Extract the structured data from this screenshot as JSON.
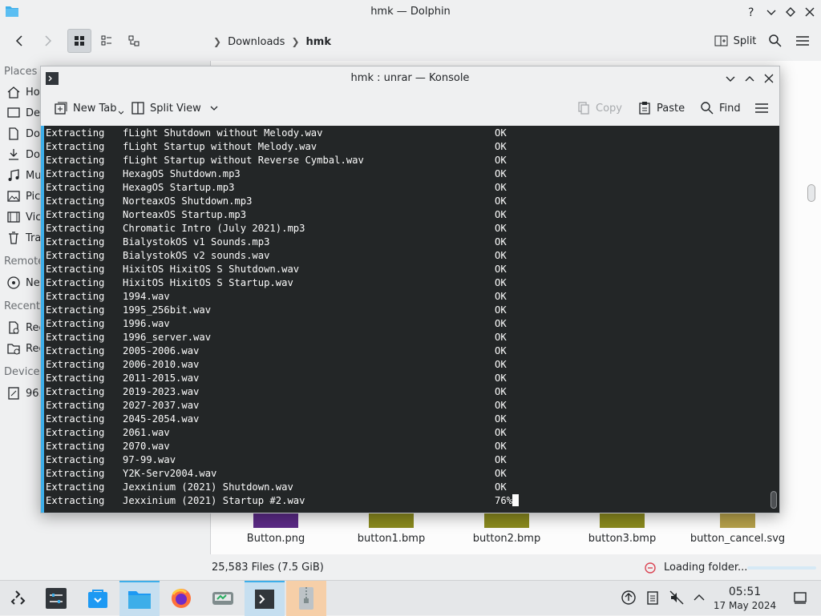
{
  "dolphin": {
    "title": "hmk — Dolphin",
    "split_label": "Split",
    "breadcrumb": [
      "Downloads",
      "hmk"
    ],
    "places": {
      "header": "Places",
      "items": [
        "Ho",
        "De",
        "Do",
        "Do",
        "Mu",
        "Pic",
        "Vic",
        "Tra"
      ],
      "remote_header": "Remote",
      "remote_items": [
        "Ne"
      ],
      "recent_header": "Recent",
      "recent_items": [
        "Rec",
        "Rec"
      ],
      "devices_header": "Devices",
      "devices_items": [
        "96."
      ]
    },
    "files": [
      {
        "name": "Button.png",
        "color": "#5b2a86"
      },
      {
        "name": "button1.bmp",
        "color": "#8a8a1e"
      },
      {
        "name": "button2.bmp",
        "color": "#8a8a1e"
      },
      {
        "name": "button3.bmp",
        "color": "#8a8a1e"
      },
      {
        "name": "button_cancel.svg",
        "color": "#b5a04a"
      }
    ],
    "status": {
      "count": "25,583 Files (7.5 GiB)",
      "loading": "Loading folder..."
    }
  },
  "konsole": {
    "title": "hmk : unrar — Konsole",
    "toolbar": {
      "new_tab": "New Tab",
      "split_view": "Split View",
      "copy": "Copy",
      "paste": "Paste",
      "find": "Find"
    },
    "lines": [
      {
        "action": "Extracting",
        "file": "fLight Shutdown without Melody.wav",
        "status": "OK"
      },
      {
        "action": "Extracting",
        "file": "fLight Startup without Melody.wav",
        "status": "OK"
      },
      {
        "action": "Extracting",
        "file": "fLight Startup without Reverse Cymbal.wav",
        "status": "OK"
      },
      {
        "action": "Extracting",
        "file": "HexagOS Shutdown.mp3",
        "status": "OK"
      },
      {
        "action": "Extracting",
        "file": "HexagOS Startup.mp3",
        "status": "OK"
      },
      {
        "action": "Extracting",
        "file": "NorteaxOS Shutdown.mp3",
        "status": "OK"
      },
      {
        "action": "Extracting",
        "file": "NorteaxOS Startup.mp3",
        "status": "OK"
      },
      {
        "action": "Extracting",
        "file": "Chromatic Intro (July 2021).mp3",
        "status": "OK"
      },
      {
        "action": "Extracting",
        "file": "BialystokOS v1 Sounds.mp3",
        "status": "OK"
      },
      {
        "action": "Extracting",
        "file": "BialystokOS v2 sounds.wav",
        "status": "OK"
      },
      {
        "action": "Extracting",
        "file": "HixitOS HixitOS S Shutdown.wav",
        "status": "OK"
      },
      {
        "action": "Extracting",
        "file": "HixitOS HixitOS S Startup.wav",
        "status": "OK"
      },
      {
        "action": "Extracting",
        "file": "1994.wav",
        "status": "OK"
      },
      {
        "action": "Extracting",
        "file": "1995_256bit.wav",
        "status": "OK"
      },
      {
        "action": "Extracting",
        "file": "1996.wav",
        "status": "OK"
      },
      {
        "action": "Extracting",
        "file": "1996_server.wav",
        "status": "OK"
      },
      {
        "action": "Extracting",
        "file": "2005-2006.wav",
        "status": "OK"
      },
      {
        "action": "Extracting",
        "file": "2006-2010.wav",
        "status": "OK"
      },
      {
        "action": "Extracting",
        "file": "2011-2015.wav",
        "status": "OK"
      },
      {
        "action": "Extracting",
        "file": "2019-2023.wav",
        "status": "OK"
      },
      {
        "action": "Extracting",
        "file": "2027-2037.wav",
        "status": "OK"
      },
      {
        "action": "Extracting",
        "file": "2045-2054.wav",
        "status": "OK"
      },
      {
        "action": "Extracting",
        "file": "2061.wav",
        "status": "OK"
      },
      {
        "action": "Extracting",
        "file": "2070.wav",
        "status": "OK"
      },
      {
        "action": "Extracting",
        "file": "97-99.wav",
        "status": "OK"
      },
      {
        "action": "Extracting",
        "file": "Y2K-Serv2004.wav",
        "status": "OK"
      },
      {
        "action": "Extracting",
        "file": "Jexxinium (2021) Shutdown.wav",
        "status": "OK"
      },
      {
        "action": "Extracting",
        "file": "Jexxinium (2021) Startup #2.wav",
        "status": "76%"
      }
    ]
  },
  "taskbar": {
    "time": "05:51",
    "date": "17 May 2024",
    "apps": [
      "application-launcher-icon",
      "system-settings-icon",
      "discover-icon",
      "dolphin-icon",
      "firefox-icon",
      "disk-usage-icon",
      "konsole-icon",
      "archive-icon"
    ]
  },
  "colors": {
    "accent": "#3daee9",
    "terminal_bg": "#232627",
    "terminal_fg": "#fcfcfc",
    "error_red": "#da4453"
  }
}
